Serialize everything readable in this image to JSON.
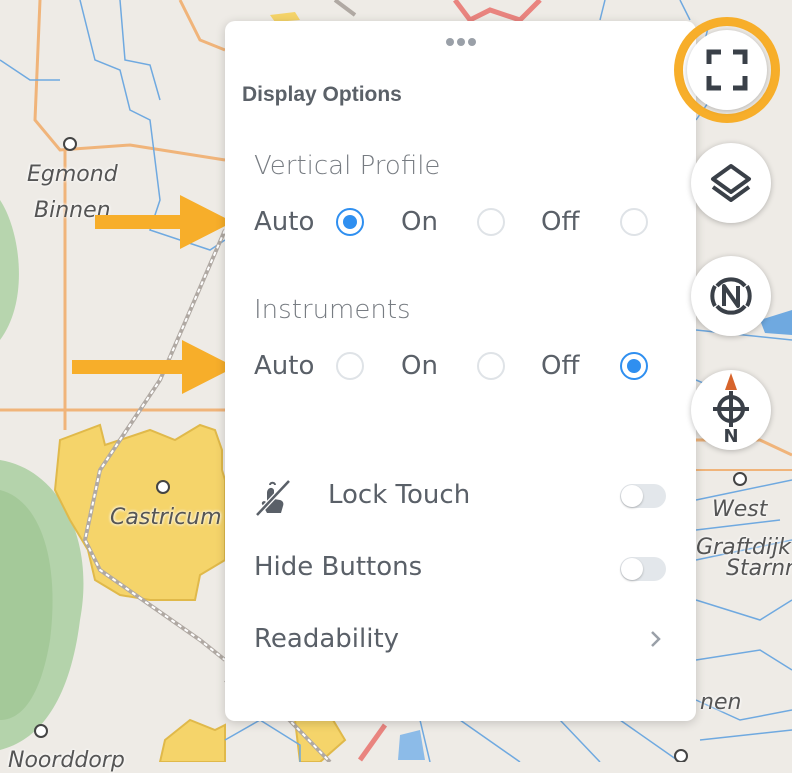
{
  "map": {
    "place_labels": [
      {
        "name": "Egmond"
      },
      {
        "name": "Binnen"
      },
      {
        "name": "Castricum"
      },
      {
        "name": "West"
      },
      {
        "name": "Graftdijk"
      },
      {
        "name": "Starnm"
      },
      {
        "name": "nen"
      },
      {
        "name": "Noorddorp"
      }
    ]
  },
  "panel": {
    "title": "Display Options",
    "vertical_profile": {
      "label": "Vertical Profile",
      "options": [
        "Auto",
        "On",
        "Off"
      ],
      "selected": "Auto"
    },
    "instruments": {
      "label": "Instruments",
      "options": [
        "Auto",
        "On",
        "Off"
      ],
      "selected": "Off"
    },
    "lock_touch": {
      "label": "Lock Touch",
      "enabled": false,
      "icon": "touch-off-icon"
    },
    "hide_buttons": {
      "label": "Hide Buttons",
      "enabled": false
    },
    "readability": {
      "label": "Readability",
      "icon": "chevron-right-icon"
    }
  },
  "side_buttons": [
    {
      "icon": "fullscreen-icon"
    },
    {
      "icon": "layers-icon"
    },
    {
      "icon": "north-up-icon"
    },
    {
      "icon": "compass-icon",
      "label": "N"
    }
  ],
  "colors": {
    "accent": "#2f8ff0",
    "annotation_orange": "#f7ae2a",
    "town_yellow": "#f5d46a",
    "forest_green": "#a9cfa0",
    "water_blue": "#6fa9e0"
  }
}
